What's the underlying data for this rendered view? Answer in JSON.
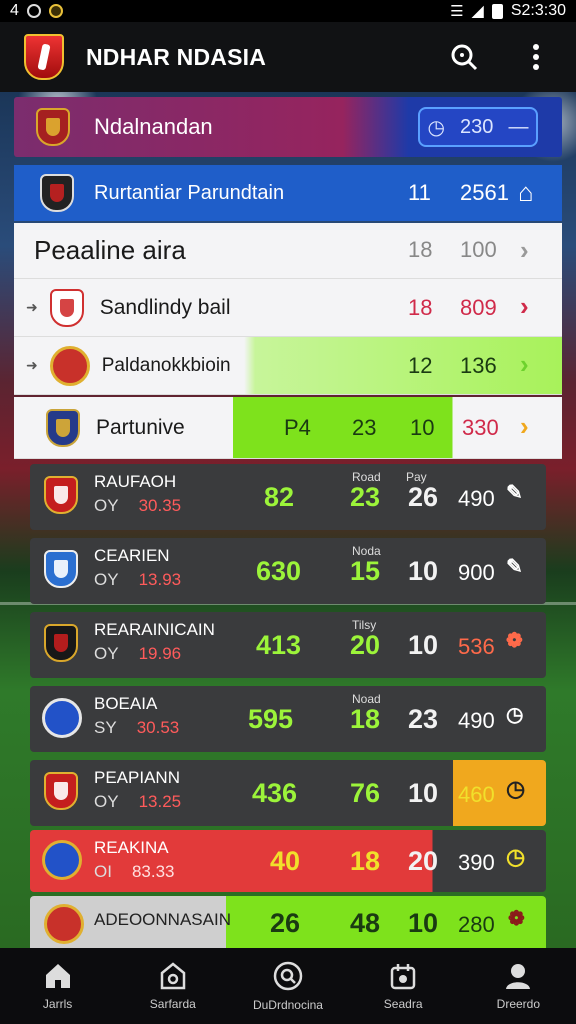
{
  "status": {
    "left_signal": "4",
    "time": "S2:3:30"
  },
  "app": {
    "title": "NDHAR NDASIA"
  },
  "header": {
    "title": "Ndalnandan",
    "pill_value": "230"
  },
  "rows": [
    {
      "label": "Rurtantiar Parundtain",
      "a": "11",
      "b": "2561"
    },
    {
      "label": "Peaaline aira",
      "a": "18",
      "b": "100"
    },
    {
      "label": "Sandlindy bail",
      "a": "18",
      "b": "809"
    },
    {
      "label": "Paldanokkbioin",
      "a": "12",
      "b": "136"
    },
    {
      "label": "Partunive",
      "p": "P4",
      "a": "23",
      "b": "10",
      "c": "330"
    }
  ],
  "cards": [
    {
      "name": "RAUFAOH",
      "sub": "OY",
      "sub_red": "30.35",
      "v1": "82",
      "v2": "23",
      "v3": "26",
      "v4": "490",
      "mini1": "Road",
      "mini2": "Pay"
    },
    {
      "name": "CEARIEN",
      "sub": "OY",
      "sub_red": "13.93",
      "v1": "630",
      "v2": "15",
      "v3": "10",
      "v4": "900",
      "mini1": "Noda",
      "mini2": ""
    },
    {
      "name": "REARAINICAIN",
      "sub": "OY",
      "sub_red": "19.96",
      "v1": "413",
      "v2": "20",
      "v3": "10",
      "v4": "536",
      "mini1": "Tilsy",
      "mini2": ""
    },
    {
      "name": "BOEAIA",
      "sub": "SY",
      "sub_red": "30.53",
      "v1": "595",
      "v2": "18",
      "v3": "23",
      "v4": "490",
      "mini1": "Noad",
      "mini2": ""
    },
    {
      "name": "PEAPIANN",
      "sub": "OY",
      "sub_red": "13.25",
      "v1": "436",
      "v2": "76",
      "v3": "10",
      "v4": "460",
      "mini1": "",
      "mini2": ""
    },
    {
      "name": "REAKINA",
      "sub": "OI",
      "sub_red": "83.33",
      "v1": "40",
      "v2": "18",
      "v3": "20",
      "v4": "390",
      "mini1": "",
      "mini2": ""
    },
    {
      "name": "ADEOONNASAIN",
      "sub": "",
      "sub_red": "",
      "v1": "26",
      "v2": "48",
      "v3": "10",
      "v4": "280",
      "mini1": "",
      "mini2": ""
    }
  ],
  "nav": [
    {
      "label": "Jarrls",
      "icon": "home-icon"
    },
    {
      "label": "Sarfarda",
      "icon": "store-icon"
    },
    {
      "label": "DuDrdnocina",
      "icon": "search-icon"
    },
    {
      "label": "Seadra",
      "icon": "calendar-icon"
    },
    {
      "label": "Dreerdo",
      "icon": "profile-icon"
    }
  ],
  "colors": {
    "accent_green": "#9cf43a",
    "accent_blue": "#1f5ec9",
    "accent_red": "#e23a3a",
    "accent_orange": "#f0a81e"
  }
}
